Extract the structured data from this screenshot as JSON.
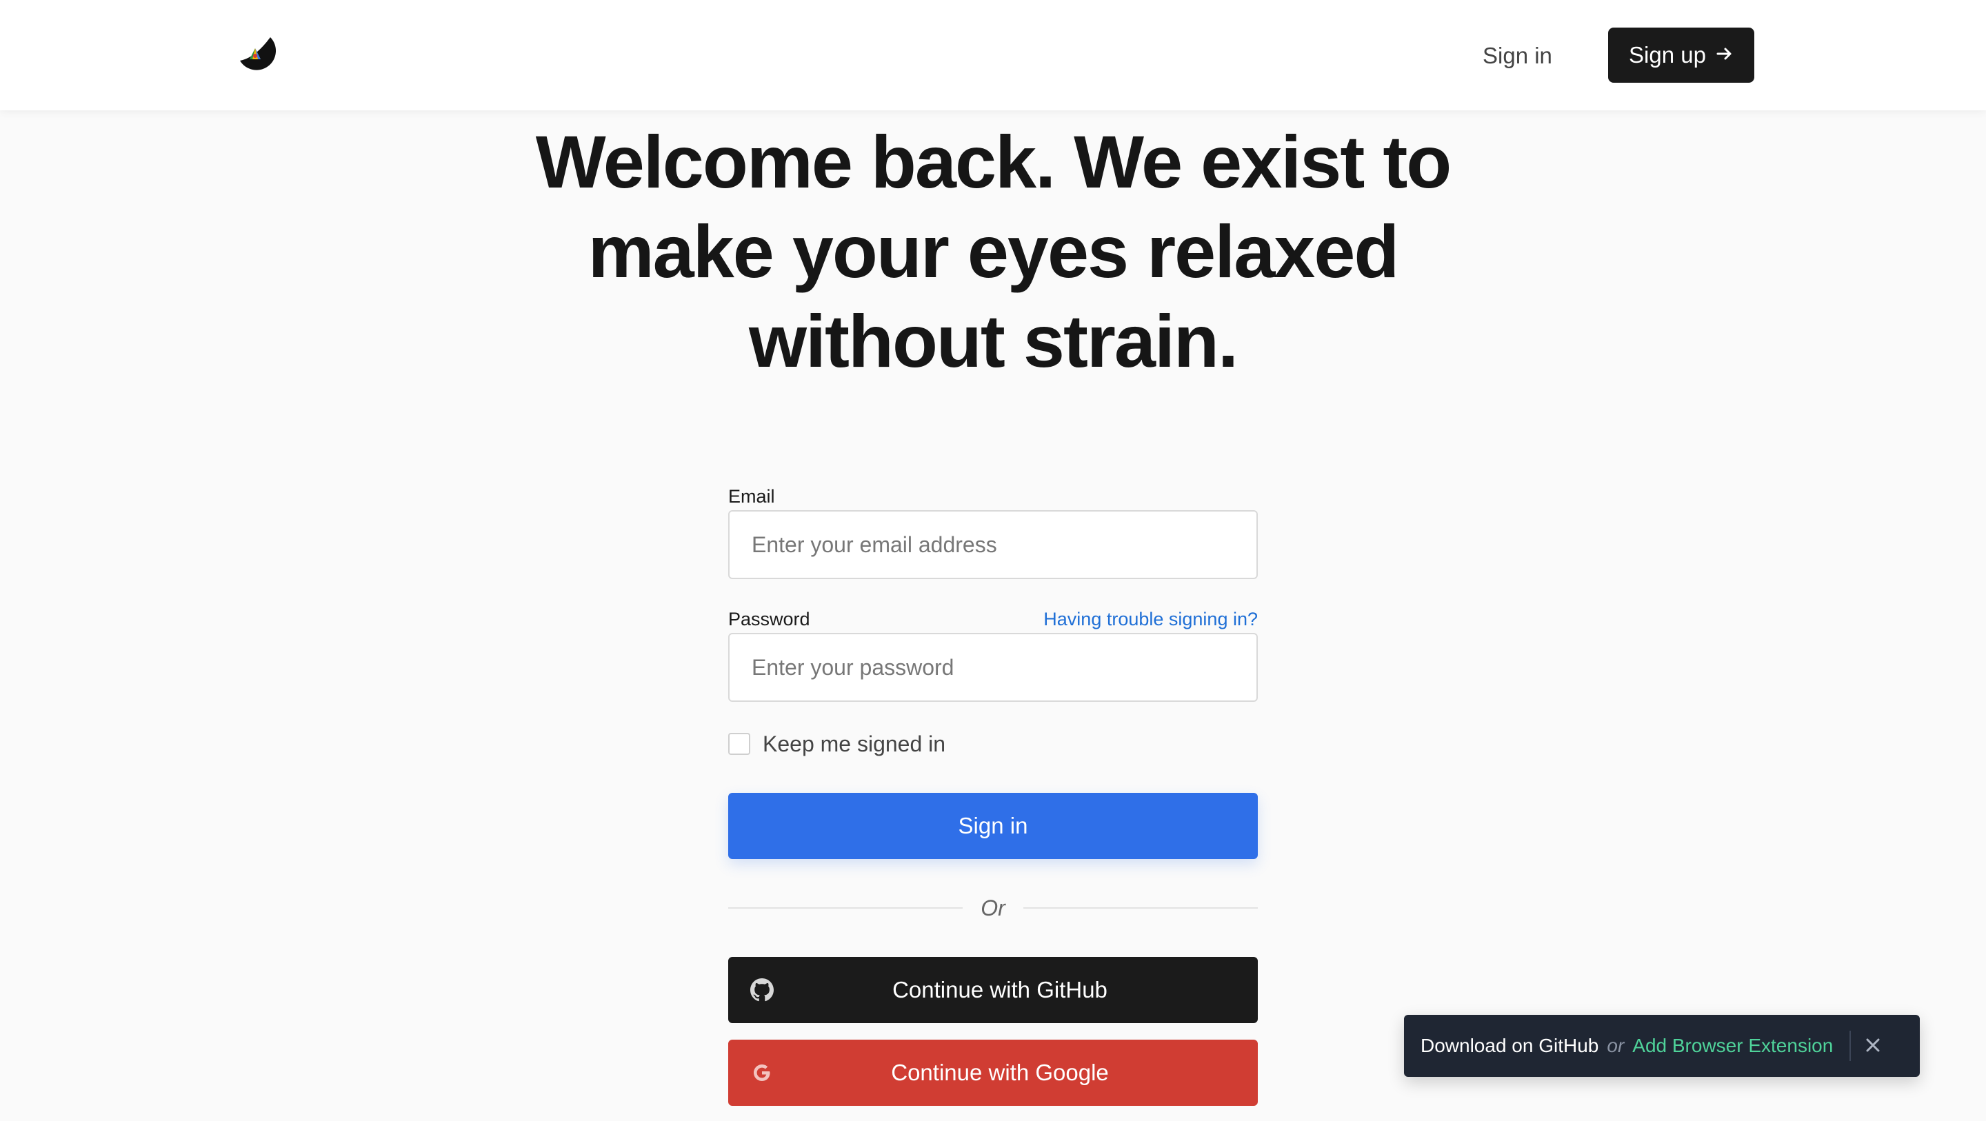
{
  "header": {
    "logo_icon": "app-logo-icon",
    "signin_label": "Sign in",
    "signup_label": "Sign up",
    "signup_icon": "arrow-right-icon"
  },
  "hero": {
    "headline": "Welcome back. We exist to make your eyes relaxed without strain."
  },
  "form": {
    "email_label": "Email",
    "email_placeholder": "Enter your email address",
    "email_value": "",
    "password_label": "Password",
    "password_placeholder": "Enter your password",
    "password_value": "",
    "trouble_link": "Having trouble signing in?",
    "keep_signed_in_label": "Keep me signed in",
    "keep_signed_in_checked": false,
    "signin_button": "Sign in",
    "divider_text": "Or",
    "github_button": "Continue with GitHub",
    "github_icon": "github-icon",
    "google_button": "Continue with Google",
    "google_icon": "google-icon"
  },
  "toast": {
    "download_github": "Download on GitHub",
    "or_text": "or",
    "add_extension": "Add Browser Extension",
    "close_icon": "close-icon"
  },
  "colors": {
    "primary_blue": "#2f6fe8",
    "github_black": "#1b1b1b",
    "google_red": "#d03d33",
    "link_blue": "#1f6fd6",
    "toast_bg": "#1f2633",
    "toast_accent": "#4fd39a"
  }
}
